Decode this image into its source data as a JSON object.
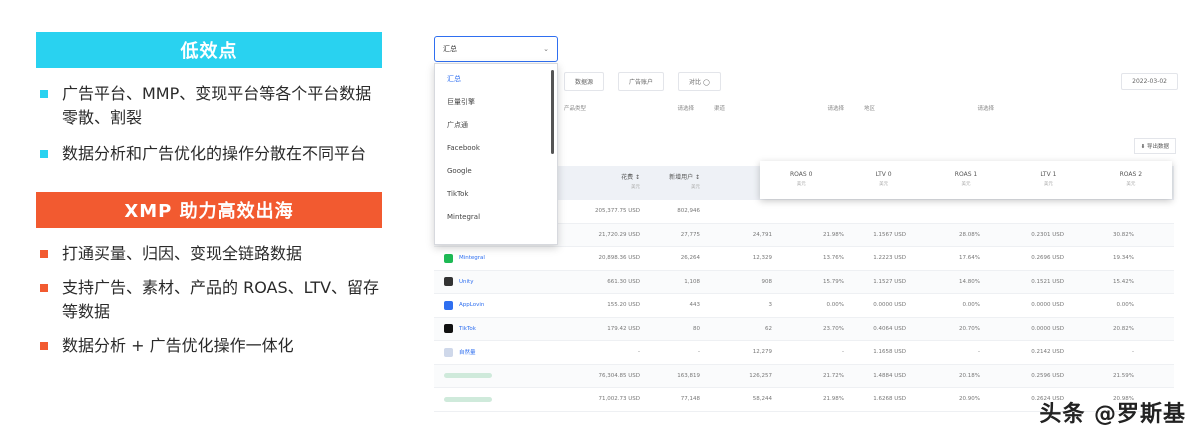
{
  "left": {
    "banner1": "低效点",
    "problems": [
      "广告平台、MMP、变现平台等各个平台数据零散、割裂",
      "数据分析和广告优化的操作分散在不同平台"
    ],
    "banner2": "XMP 助力高效出海",
    "solutions": [
      "打通买量、归因、变现全链路数据",
      "支持广告、素材、产品的 ROAS、LTV、留存等数据",
      "数据分析 + 广告优化操作一体化"
    ]
  },
  "screenshot": {
    "dropdown": {
      "selected": "汇总",
      "options": [
        "汇总",
        "巨量引擎",
        "广点通",
        "Facebook",
        "Google",
        "TikTok",
        "Mintegral"
      ]
    },
    "toolbar": {
      "tab1": "数据源",
      "tab2": "广告账户",
      "tab3": "对比 ◯",
      "date": "2022-03-02"
    },
    "filters": [
      {
        "label": "产品类型",
        "placeholder": "请选择"
      },
      {
        "label": "渠道",
        "placeholder": "请选择"
      },
      {
        "label": "地区",
        "placeholder": "请选择"
      }
    ],
    "export_label": "⬇ 导出数据",
    "popover_cols": [
      {
        "label": "ROAS 0",
        "unit": "美元"
      },
      {
        "label": "LTV 0",
        "unit": "美元"
      },
      {
        "label": "ROAS 1",
        "unit": "美元"
      },
      {
        "label": "LTV 1",
        "unit": "美元"
      },
      {
        "label": "ROAS 2",
        "unit": "美元"
      }
    ],
    "header": [
      {
        "label": "花费 ↕",
        "unit": "美元"
      },
      {
        "label": "新增用户 ↕",
        "unit": "美元"
      }
    ],
    "rows": [
      {
        "name": "",
        "icon": "",
        "blur": false,
        "cells": [
          "205,377.75 USD",
          "802,946",
          "",
          "",
          "",
          "",
          "",
          "",
          ""
        ]
      },
      {
        "name": "",
        "icon": "",
        "blur": true,
        "cells": [
          "21,720.29 USD",
          "27,775",
          "24,791",
          "21.98%",
          "1.1567 USD",
          "28.08%",
          "0.2301 USD",
          "30.82%"
        ]
      },
      {
        "name": "Mintegral",
        "icon": "#1db954",
        "blur": false,
        "cells": [
          "20,898.36 USD",
          "26,264",
          "12,329",
          "13.76%",
          "1.2223 USD",
          "17.64%",
          "0.2696 USD",
          "19.34%"
        ]
      },
      {
        "name": "Unity",
        "icon": "#333333",
        "blur": false,
        "cells": [
          "661.30 USD",
          "1,108",
          "908",
          "15.79%",
          "1.1527 USD",
          "14.80%",
          "0.1521 USD",
          "15.42%"
        ]
      },
      {
        "name": "AppLovin",
        "icon": "#2f6ff0",
        "blur": false,
        "cells": [
          "155.20 USD",
          "443",
          "3",
          "0.00%",
          "0.0000 USD",
          "0.00%",
          "0.0000 USD",
          "0.00%"
        ]
      },
      {
        "name": "TikTok",
        "icon": "#111111",
        "blur": false,
        "cells": [
          "179.42 USD",
          "80",
          "62",
          "23.70%",
          "0.4064 USD",
          "20.70%",
          "0.0000 USD",
          "20.82%"
        ]
      },
      {
        "name": "自然量",
        "icon": "#cfd8ea",
        "blur": false,
        "cells": [
          "-",
          "-",
          "12,279",
          "-",
          "1.1658 USD",
          "-",
          "0.2142 USD",
          "-"
        ]
      },
      {
        "name": "",
        "icon": "",
        "blur": true,
        "cells": [
          "76,304.85 USD",
          "163,819",
          "126,257",
          "21.72%",
          "1.4884 USD",
          "20.18%",
          "0.2596 USD",
          "21.59%"
        ]
      },
      {
        "name": "",
        "icon": "",
        "blur": true,
        "cells": [
          "71,002.73 USD",
          "77,148",
          "58,244",
          "21.98%",
          "1.6268 USD",
          "20.90%",
          "0.2624 USD",
          "20.98%"
        ]
      }
    ]
  },
  "watermark": "头条 @罗斯基",
  "colors": {
    "cyan": "#29d2f0",
    "orange": "#f25a30",
    "link": "#2f6ff0"
  }
}
